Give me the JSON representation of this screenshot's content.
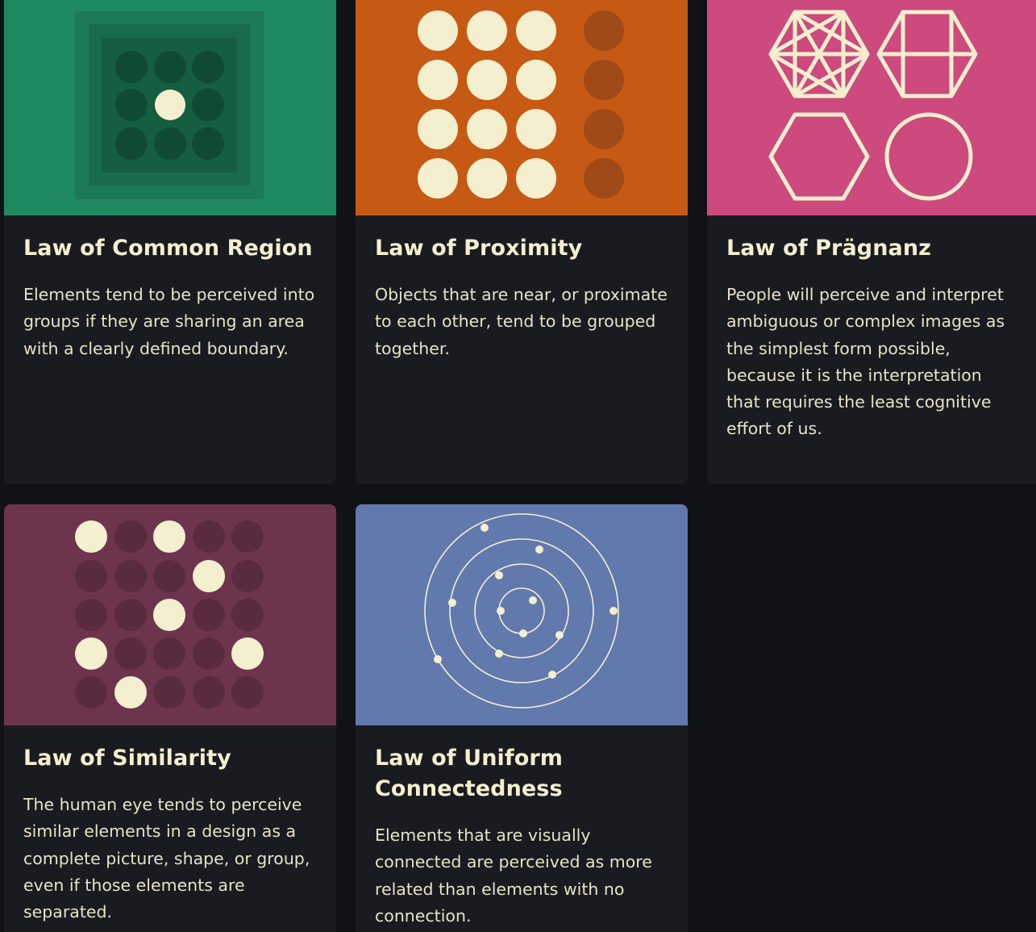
{
  "cards": [
    {
      "title": "Law of Common Region",
      "description": "Elements tend to be perceived into groups if they are sharing an area with a clearly defined boundary.",
      "illustration": "common-region-nested-squares",
      "bg_color": "#1f8a5f"
    },
    {
      "title": "Law of Proximity",
      "description": "Objects that are near, or proximate to each other, tend to be grouped together.",
      "illustration": "proximity-dot-grid",
      "bg_color": "#c65a15"
    },
    {
      "title": "Law of Prägnanz",
      "description": "People will perceive and interpret ambiguous or complex images as the simplest form possible, because it is the interpretation that requires the least cognitive effort of us.",
      "illustration": "pragnanz-hexagons",
      "bg_color": "#cc4a7e"
    },
    {
      "title": "Law of Similarity",
      "description": "The human eye tends to perceive similar elements in a design as a complete picture, shape, or group, even if those elements are separated.",
      "illustration": "similarity-dot-grid",
      "bg_color": "#6d354d"
    },
    {
      "title": "Law of Uniform Connectedness",
      "description": "Elements that are visually connected are perceived as more related than elements with no connection.",
      "illustration": "uniform-connectedness-orbits",
      "bg_color": "#6179ad"
    }
  ],
  "colors": {
    "page_bg": "#111216",
    "card_bg": "#1a1b20",
    "cream": "#f4efcf"
  }
}
